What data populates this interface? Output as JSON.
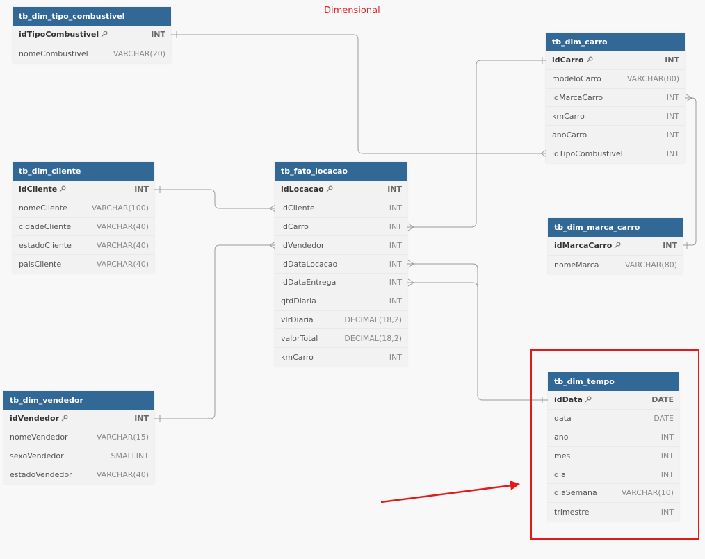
{
  "diagram_title": "Dimensional",
  "tables": {
    "tipo_combustivel": {
      "name": "tb_dim_tipo_combustivel",
      "fields": [
        {
          "name": "idTipoCombustivel",
          "type": "INT"
        },
        {
          "name": "nomeCombustivel",
          "type": "VARCHAR(20)"
        }
      ]
    },
    "carro": {
      "name": "tb_dim_carro",
      "fields": [
        {
          "name": "idCarro",
          "type": "INT"
        },
        {
          "name": "modeloCarro",
          "type": "VARCHAR(80)"
        },
        {
          "name": "idMarcaCarro",
          "type": "INT"
        },
        {
          "name": "kmCarro",
          "type": "INT"
        },
        {
          "name": "anoCarro",
          "type": "INT"
        },
        {
          "name": "idTipoCombustivel",
          "type": "INT"
        }
      ]
    },
    "cliente": {
      "name": "tb_dim_cliente",
      "fields": [
        {
          "name": "idCliente",
          "type": "INT"
        },
        {
          "name": "nomeCliente",
          "type": "VARCHAR(100)"
        },
        {
          "name": "cidadeCliente",
          "type": "VARCHAR(40)"
        },
        {
          "name": "estadoCliente",
          "type": "VARCHAR(40)"
        },
        {
          "name": "paisCliente",
          "type": "VARCHAR(40)"
        }
      ]
    },
    "fato_locacao": {
      "name": "tb_fato_locacao",
      "fields": [
        {
          "name": "idLocacao",
          "type": "INT"
        },
        {
          "name": "idCliente",
          "type": "INT"
        },
        {
          "name": "idCarro",
          "type": "INT"
        },
        {
          "name": "idVendedor",
          "type": "INT"
        },
        {
          "name": "idDataLocacao",
          "type": "INT"
        },
        {
          "name": "idDataEntrega",
          "type": "INT"
        },
        {
          "name": "qtdDiaria",
          "type": "INT"
        },
        {
          "name": "vlrDiaria",
          "type": "DECIMAL(18,2)"
        },
        {
          "name": "valorTotal",
          "type": "DECIMAL(18,2)"
        },
        {
          "name": "kmCarro",
          "type": "INT"
        }
      ]
    },
    "marca_carro": {
      "name": "tb_dim_marca_carro",
      "fields": [
        {
          "name": "idMarcaCarro",
          "type": "INT"
        },
        {
          "name": "nomeMarca",
          "type": "VARCHAR(80)"
        }
      ]
    },
    "vendedor": {
      "name": "tb_dim_vendedor",
      "fields": [
        {
          "name": "idVendedor",
          "type": "INT"
        },
        {
          "name": "nomeVendedor",
          "type": "VARCHAR(15)"
        },
        {
          "name": "sexoVendedor",
          "type": "SMALLINT"
        },
        {
          "name": "estadoVendedor",
          "type": "VARCHAR(40)"
        }
      ]
    },
    "tempo": {
      "name": "tb_dim_tempo",
      "fields": [
        {
          "name": "idData",
          "type": "DATE"
        },
        {
          "name": "data",
          "type": "DATE"
        },
        {
          "name": "ano",
          "type": "INT"
        },
        {
          "name": "mes",
          "type": "INT"
        },
        {
          "name": "dia",
          "type": "INT"
        },
        {
          "name": "diaSemana",
          "type": "VARCHAR(10)"
        },
        {
          "name": "trimestre",
          "type": "INT"
        }
      ]
    }
  },
  "colors": {
    "header": "#316896",
    "title": "#e02020",
    "annotation": "#e41a1a",
    "connector": "#9a9a9a"
  },
  "icons": {
    "primary_key": "key-icon",
    "one_end": "one-cardinality-mark",
    "many_end": "many-cardinality-crowfoot"
  }
}
